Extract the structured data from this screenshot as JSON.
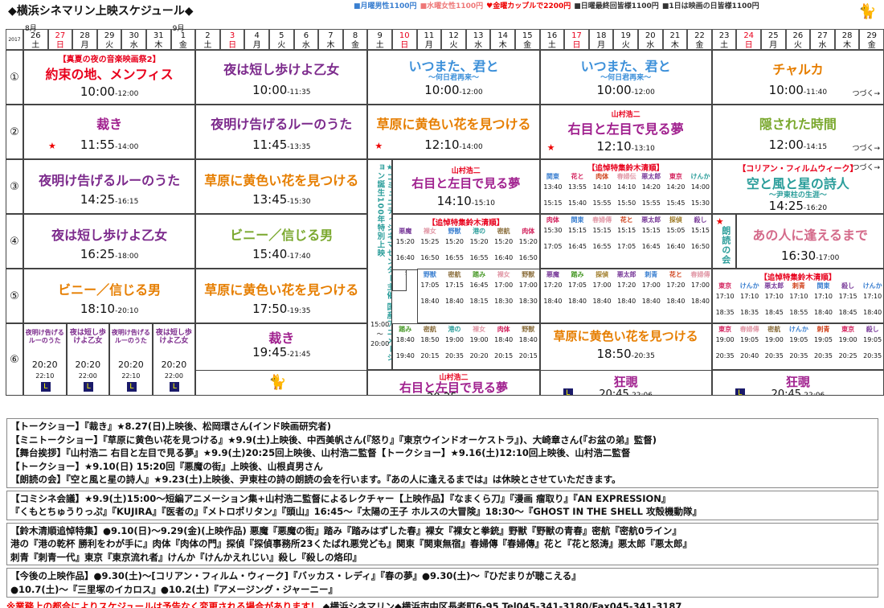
{
  "header": {
    "title": "◆横浜シネマリン上映スケジュール◆",
    "prices": [
      {
        "t": "■月曜男性1100円",
        "c": "#3a7fd0"
      },
      {
        "t": "■水曜女性1100円",
        "c": "#e77"
      },
      {
        "t": "♥金曜カップルで2200円",
        "c": "#e00"
      },
      {
        "t": "■日曜最終回皆様1100円",
        "c": "#333"
      },
      {
        "t": "■1日は映画の日皆様1100円",
        "c": "#333"
      }
    ]
  },
  "months": {
    "year": "2017",
    "aug": "8月",
    "sep": "9月"
  },
  "days": [
    [
      "26",
      "土"
    ],
    [
      "27",
      "日"
    ],
    [
      "28",
      "月"
    ],
    [
      "29",
      "火"
    ],
    [
      "30",
      "水"
    ],
    [
      "31",
      "木"
    ],
    [
      "1",
      "金"
    ],
    [
      "2",
      "土"
    ],
    [
      "3",
      "日"
    ],
    [
      "4",
      "月"
    ],
    [
      "5",
      "火"
    ],
    [
      "6",
      "水"
    ],
    [
      "7",
      "木"
    ],
    [
      "8",
      "金"
    ],
    [
      "9",
      "土"
    ],
    [
      "10",
      "日"
    ],
    [
      "11",
      "月"
    ],
    [
      "12",
      "火"
    ],
    [
      "13",
      "水"
    ],
    [
      "14",
      "木"
    ],
    [
      "15",
      "金"
    ],
    [
      "16",
      "土"
    ],
    [
      "17",
      "日"
    ],
    [
      "18",
      "月"
    ],
    [
      "19",
      "火"
    ],
    [
      "20",
      "水"
    ],
    [
      "21",
      "木"
    ],
    [
      "22",
      "金"
    ],
    [
      "23",
      "土"
    ],
    [
      "24",
      "日"
    ],
    [
      "25",
      "月"
    ],
    [
      "26",
      "火"
    ],
    [
      "27",
      "水"
    ],
    [
      "28",
      "木"
    ],
    [
      "29",
      "金"
    ]
  ],
  "rows": [
    "①",
    "②",
    "③",
    "④",
    "⑤",
    "⑥"
  ],
  "sched": {
    "r1a": {
      "tag": "【真夏の夜の音楽映画祭2】",
      "title": "約束の地、メンフィス",
      "time": "10:00",
      "end": "-12:00"
    },
    "r1b": {
      "title": "夜は短し歩けよ乙女",
      "time": "10:00",
      "end": "-11:35"
    },
    "r1c": {
      "title": "いつまた、君と",
      "sub": "〜何日君再来〜",
      "time": "10:00",
      "end": "-12:00"
    },
    "r1d": {
      "title": "いつまた、君と",
      "sub": "〜何日君再来〜",
      "time": "10:00",
      "end": "-12:00"
    },
    "r1e": {
      "title": "チャルカ",
      "time": "10:00",
      "end": "-11:40",
      "cont": "つづく→"
    },
    "r2a": {
      "title": "裁き",
      "time": "11:55",
      "end": "-14:00"
    },
    "r2b": {
      "title": "夜明け告げるルーのうた",
      "time": "11:45",
      "end": "-13:35"
    },
    "r2c": {
      "title": "草原に黄色い花を見つける",
      "time": "12:10",
      "end": "-14:00"
    },
    "r2d": {
      "pre": "山村浩二",
      "title": "右目と左目で見る夢",
      "time": "12:10",
      "end": "-13:10"
    },
    "r2e": {
      "title": "隠された時間",
      "time": "12:00",
      "end": "-14:15",
      "cont": "つづく→"
    },
    "r3a": {
      "title": "夜明け告げるルーのうた",
      "time": "14:25",
      "end": "-16:15"
    },
    "r3b": {
      "title": "草原に黄色い花を見つける",
      "time": "13:45",
      "end": "-15:30"
    },
    "r3c": {
      "pre": "山村浩二",
      "title": "右目と左目で見る夢",
      "time": "14:10",
      "end": "-15:10"
    },
    "r3d": {
      "tag": "【追悼特集鈴木清順】"
    },
    "r3e": {
      "tag": "【コリアン・フィルムウィーク】",
      "cont": "つづく→",
      "title": "空と風と星の詩人",
      "sub": "〜尹東柱の生涯〜",
      "time": "14:25",
      "end": "-16:20"
    },
    "r4a": {
      "title": "夜は短し歩けよ乙女",
      "time": "16:25",
      "end": "-18:00"
    },
    "r4b": {
      "title": "ビニー／信じる男",
      "time": "15:40",
      "end": "-17:40"
    },
    "r4c": {
      "tag": "【追悼特集鈴木清順】"
    },
    "r4e": {
      "title": "あの人に逢えるまで",
      "time": "16:30",
      "end": "-17:00",
      "vert": "朗読の会"
    },
    "r4f": {
      "tag": "【追悼特集鈴木清順】"
    },
    "r5a": {
      "title": "ビニー／信じる男",
      "time": "18:10",
      "end": "-20:10"
    },
    "r5b": {
      "title": "草原に黄色い花を見つける",
      "time": "17:50",
      "end": "-19:35"
    },
    "r6a": {
      "title": "裁き",
      "time": "19:45",
      "end": "-21:45"
    },
    "r6b": {
      "title": "草原に黄色い花を見つける",
      "time": "18:50",
      "end": "-20:35"
    },
    "r6c": {
      "pre": "山村浩二",
      "title": "右目と左目で見る夢",
      "time": "20:25",
      "end": "-21:25"
    },
    "r6d": {
      "title": "狂覗",
      "time": "20:45",
      "end": "-22:06"
    },
    "r6e": {
      "title": "狂覗",
      "time": "20:45",
      "end": "-22:06"
    },
    "r6m": [
      {
        "t": "夜明け告げるルーのうた",
        "time": "20:20",
        "end": "22:10"
      },
      {
        "t": "夜は短し歩けよ乙女",
        "time": "20:20",
        "end": "22:00"
      },
      {
        "t": "夜明け告げるルーのうた",
        "time": "20:20",
        "end": "22:10"
      },
      {
        "t": "夜は短し歩けよ乙女",
        "time": "20:20",
        "end": "22:00"
      }
    ],
    "vert1": "★コミュニティシネマセンター主催 国産アニメーション誕生100年特別上映",
    "vert1t": [
      "15:00",
      "〜",
      "20:00"
    ],
    "vert2": "★山根貞男さんトークショー",
    "suzuki_r3": [
      [
        "関東",
        "13:40",
        "15:15"
      ],
      [
        "花と",
        "13:55",
        "15:40"
      ],
      [
        "肉体",
        "14:10",
        "15:55"
      ],
      [
        "春婦伝",
        "14:10",
        "15:50"
      ],
      [
        "悪太郎",
        "14:20",
        "15:55"
      ],
      [
        "東京",
        "14:20",
        "15:45"
      ],
      [
        "けんか",
        "14:00",
        "15:30"
      ]
    ],
    "suzuki_r4c": [
      [
        "悪魔",
        "15:20",
        "16:40"
      ],
      [
        "裸女",
        "15:25",
        "16:50"
      ],
      [
        "野獣",
        "15:20",
        "16:55"
      ],
      [
        "港の",
        "15:20",
        "16:55"
      ],
      [
        "密航",
        "15:20",
        "16:40"
      ],
      [
        "肉体",
        "15:20",
        "16:50"
      ]
    ],
    "suzuki_r4d": [
      [
        "肉体",
        "15:30",
        "17:05"
      ],
      [
        "関東",
        "15:15",
        "16:45"
      ],
      [
        "春婦傳",
        "15:15",
        "16:55"
      ],
      [
        "花と",
        "15:15",
        "17:05"
      ],
      [
        "悪太郎",
        "15:15",
        "16:45"
      ],
      [
        "探偵",
        "15:05",
        "16:40"
      ],
      [
        "殺し",
        "15:15",
        "16:50"
      ]
    ],
    "suzuki_r5c": [
      [
        "野獣",
        "17:05",
        "18:40"
      ],
      [
        "密航",
        "17:15",
        "18:40"
      ],
      [
        "踏み",
        "16:45",
        "18:15"
      ],
      [
        "裸女",
        "17:00",
        "18:30"
      ],
      [
        "野獣",
        "17:00",
        "18:30"
      ]
    ],
    "suzuki_r5d": [
      [
        "悪魔",
        "17:20",
        "18:40"
      ],
      [
        "踏み",
        "17:05",
        "18:40"
      ],
      [
        "探偵",
        "17:00",
        "18:40"
      ],
      [
        "悪太郎",
        "17:20",
        "18:40"
      ],
      [
        "刺青",
        "17:00",
        "18:40"
      ],
      [
        "花と",
        "17:20",
        "18:40"
      ],
      [
        "春婦傳",
        "17:00",
        "18:40"
      ]
    ],
    "suzuki_r5f": [
      [
        "東京",
        "17:10",
        "18:35"
      ],
      [
        "けんか",
        "17:10",
        "18:35"
      ],
      [
        "悪太郎",
        "17:10",
        "18:45"
      ],
      [
        "刺青",
        "17:10",
        "18:55"
      ],
      [
        "関東",
        "17:10",
        "18:40"
      ],
      [
        "殺し",
        "17:15",
        "18:45"
      ],
      [
        "けんか",
        "17:10",
        "18:40"
      ]
    ],
    "suzuki_r6c": [
      [
        "踏み",
        "18:40",
        "19:40"
      ],
      [
        "密航",
        "18:50",
        "20:15"
      ],
      [
        "港の",
        "19:00",
        "20:35"
      ],
      [
        "裸女",
        "19:00",
        "20:20"
      ],
      [
        "肉体",
        "18:40",
        "20:15"
      ],
      [
        "野獣",
        "18:40",
        "20:15"
      ]
    ],
    "suzuki_r6f": [
      [
        "東京",
        "19:00",
        "20:35"
      ],
      [
        "春婦傳",
        "19:05",
        "20:40"
      ],
      [
        "密航",
        "19:00",
        "20:35"
      ],
      [
        "けんか",
        "19:05",
        "20:35"
      ],
      [
        "刺青",
        "19:05",
        "20:35"
      ],
      [
        "東京",
        "19:00",
        "20:25"
      ],
      [
        "殺し",
        "19:05",
        "20:35"
      ]
    ]
  },
  "notes": [
    [
      "【トークショー】『裁き』",
      "★8.27(日)上映後、松岡環さん(インド映画研究者)"
    ],
    [
      "【ミニトークショー】『草原に黄色い花を見つける』",
      "★9.9(土)上映後、中西美帆さん(『怒り』『東京ウインドオーケストラ』)、大崎章さん(『お盆の弟』監督)"
    ],
    [
      "【舞台挨拶】『山村浩二 右目と左目で見る夢』",
      "★9.9(土)20:25回上映後、山村浩二監督【トークショー】★9.16(土)12:10回上映後、山村浩二監督"
    ],
    [
      "【トークショー】",
      "★9.10(日) 15:20回『悪魔の街』上映後、山根貞男さん"
    ],
    [
      "【朗読の会】『空と風と星の詩人』★9.23(土)上映後、尹東柱の詩の朗読の会を行います。『あの人に逢えるまでは』は休映とさせていただきます。",
      ""
    ],
    [
      "【コミシネ会議】★9.9(土)15:00〜短編アニメーション集+山村浩二監督によるレクチャー【上映作品】『なまくら刀』『漫画 瘤取り』『AN EXPRESSION』",
      ""
    ],
    [
      "『くもとちゅうりっぷ』『KUJIRA』『医者の』『メトロポリタン』『頭山』16:45〜『太陽の王子 ホルスの大冒険』18:30〜『GHOST IN THE SHELL 攻殻機動隊』",
      ""
    ],
    [
      "【鈴木清順追悼特集】●9.10(日)〜9.29(金)(上映作品) 悪魔『悪魔の街』踏み『踏みはずした春』裸女『裸女と拳銃』野獣『野獣の青春』密航『密航0ライン』",
      ""
    ],
    [
      "港の『港の乾杯 勝利をわが手に』肉体『肉体の門』探偵『探偵事務所23くたばれ悪党ども』関東『関東無宿』春婦傳『春婦傳』花と『花と怒涛』悪太郎『悪太郎』",
      ""
    ],
    [
      "刺青『刺青一代』東京『東京流れ者』けんか『けんかえれじい』殺し『殺しの烙印』",
      ""
    ],
    [
      "【今後の上映作品】●9.30(土)〜[コリアン・フィルム・ウィーク]『バッカス・レディ』『春の夢』●9.30(土)〜『ひだまりが聴こえる』",
      ""
    ],
    [
      "●10.7(土)〜『三里塚のイカロス』●10.2(土)『アメージング・ジャーニー』",
      ""
    ]
  ],
  "footer": {
    "warn": "※業務上の都合によりスケジュールは予告なく変更される場合があります！",
    "addr": "◆横浜シネマリン◆横浜市中区長者町6-95 Tel045-341-3180/Fax045-341-3187"
  }
}
